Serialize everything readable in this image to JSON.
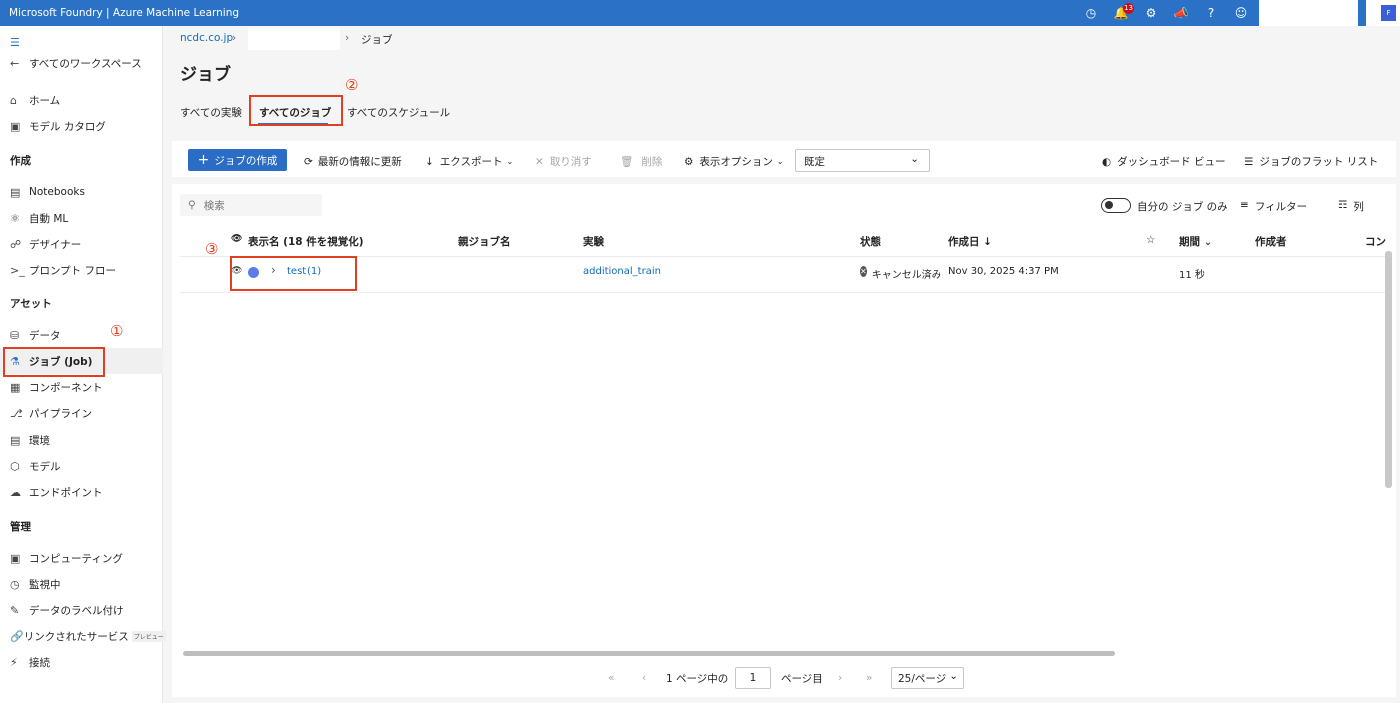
{
  "topbar": {
    "title": "Microsoft Foundry | Azure Machine Learning",
    "notification_count": "13",
    "avatar_initial": "F",
    "icons": [
      "clock-icon",
      "bell-icon",
      "gear-icon",
      "megaphone-icon",
      "help-icon",
      "smiley-icon"
    ]
  },
  "sidebar": {
    "back_label": "すべてのワークスペース",
    "home": "ホーム",
    "model_catalog": "モデル カタログ",
    "section_create": "作成",
    "notebooks": "Notebooks",
    "automl": "自動 ML",
    "designer": "デザイナー",
    "prompt_flow": "プロンプト フロー",
    "section_assets": "アセット",
    "data": "データ",
    "jobs": "ジョブ (Job)",
    "components": "コンポーネント",
    "pipelines": "パイプライン",
    "environments": "環境",
    "models": "モデル",
    "endpoints": "エンドポイント",
    "section_manage": "管理",
    "compute": "コンピューティング",
    "monitoring": "監視中",
    "labeling": "データのラベル付け",
    "linked_services": "リンクされたサービス",
    "preview_badge": "プレビュー",
    "connections": "接続"
  },
  "annotations": {
    "m1": "①",
    "m2": "②",
    "m3": "③"
  },
  "breadcrumb": {
    "org": "ncdc.co.jp",
    "current": "ジョブ"
  },
  "page": {
    "title": "ジョブ"
  },
  "tabs": {
    "experiments": "すべての実験",
    "jobs": "すべてのジョブ",
    "schedules": "すべてのスケジュール"
  },
  "toolbar": {
    "create": "ジョブの作成",
    "refresh": "最新の情報に更新",
    "export": "エクスポート",
    "cancel": "取り消す",
    "delete": "削除",
    "view_options": "表示オプション",
    "view_select": "既定",
    "dashboard": "ダッシュボード ビュー",
    "flat_list": "ジョブのフラット リスト"
  },
  "filters": {
    "search_placeholder": "検索",
    "my_jobs": "自分の ジョブ のみ",
    "filter": "フィルター",
    "columns": "列"
  },
  "table": {
    "headers": {
      "display_name": "表示名 (18 件を視覚化)",
      "parent": "親ジョブ名",
      "experiment": "実験",
      "status": "状態",
      "created": "作成日 ↓",
      "duration": "期間",
      "creator": "作成者",
      "compute": "コン"
    },
    "rows": [
      {
        "name": "test",
        "count": "(1)",
        "experiment": "additional_train",
        "status": "キャンセル済み",
        "created": "Nov 30, 2025 4:37 PM",
        "duration": "11 秒"
      }
    ]
  },
  "pager": {
    "of_text": "1 ページ中の",
    "page_value": "1",
    "page_suffix": "ページ目",
    "page_size": "25/ページ"
  }
}
